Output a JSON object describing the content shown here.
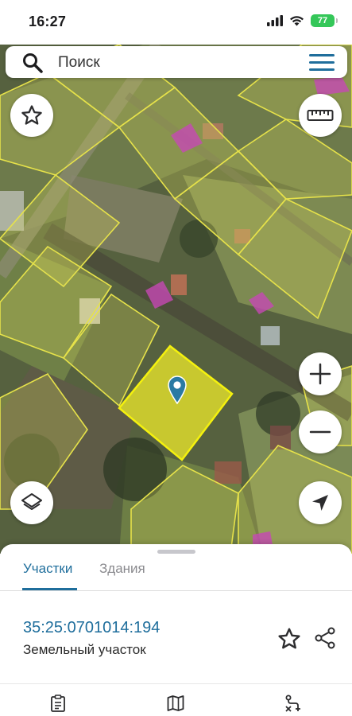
{
  "status_bar": {
    "time": "16:27",
    "battery": "77",
    "battery_color": "#34c759",
    "icons": [
      "signal-icon",
      "wifi-icon",
      "battery-icon"
    ]
  },
  "search": {
    "placeholder": "Поиск",
    "search_icon": "search-icon",
    "menu_icon": "hamburger-menu-icon"
  },
  "map": {
    "type": "satellite",
    "controls": [
      "favorites-star-icon",
      "ruler-icon",
      "zoom-in-icon",
      "zoom-out-icon",
      "layers-icon",
      "location-arrow-icon"
    ],
    "parcel_outline_color": "#e6e24a",
    "selected_parcel_color": "#e8e62a",
    "building_highlight_color": "#c548b4",
    "marker_color": "#2a7aa3"
  },
  "sheet": {
    "tabs": [
      {
        "label": "Участки",
        "active": true
      },
      {
        "label": "Здания",
        "active": false
      }
    ],
    "cadastral_number": "35:25:0701014:194",
    "object_type": "Земельный участок",
    "accent_color": "#1f6e9c"
  },
  "bottom_nav": [
    "clipboard-icon",
    "map-book-icon",
    "route-icon"
  ]
}
